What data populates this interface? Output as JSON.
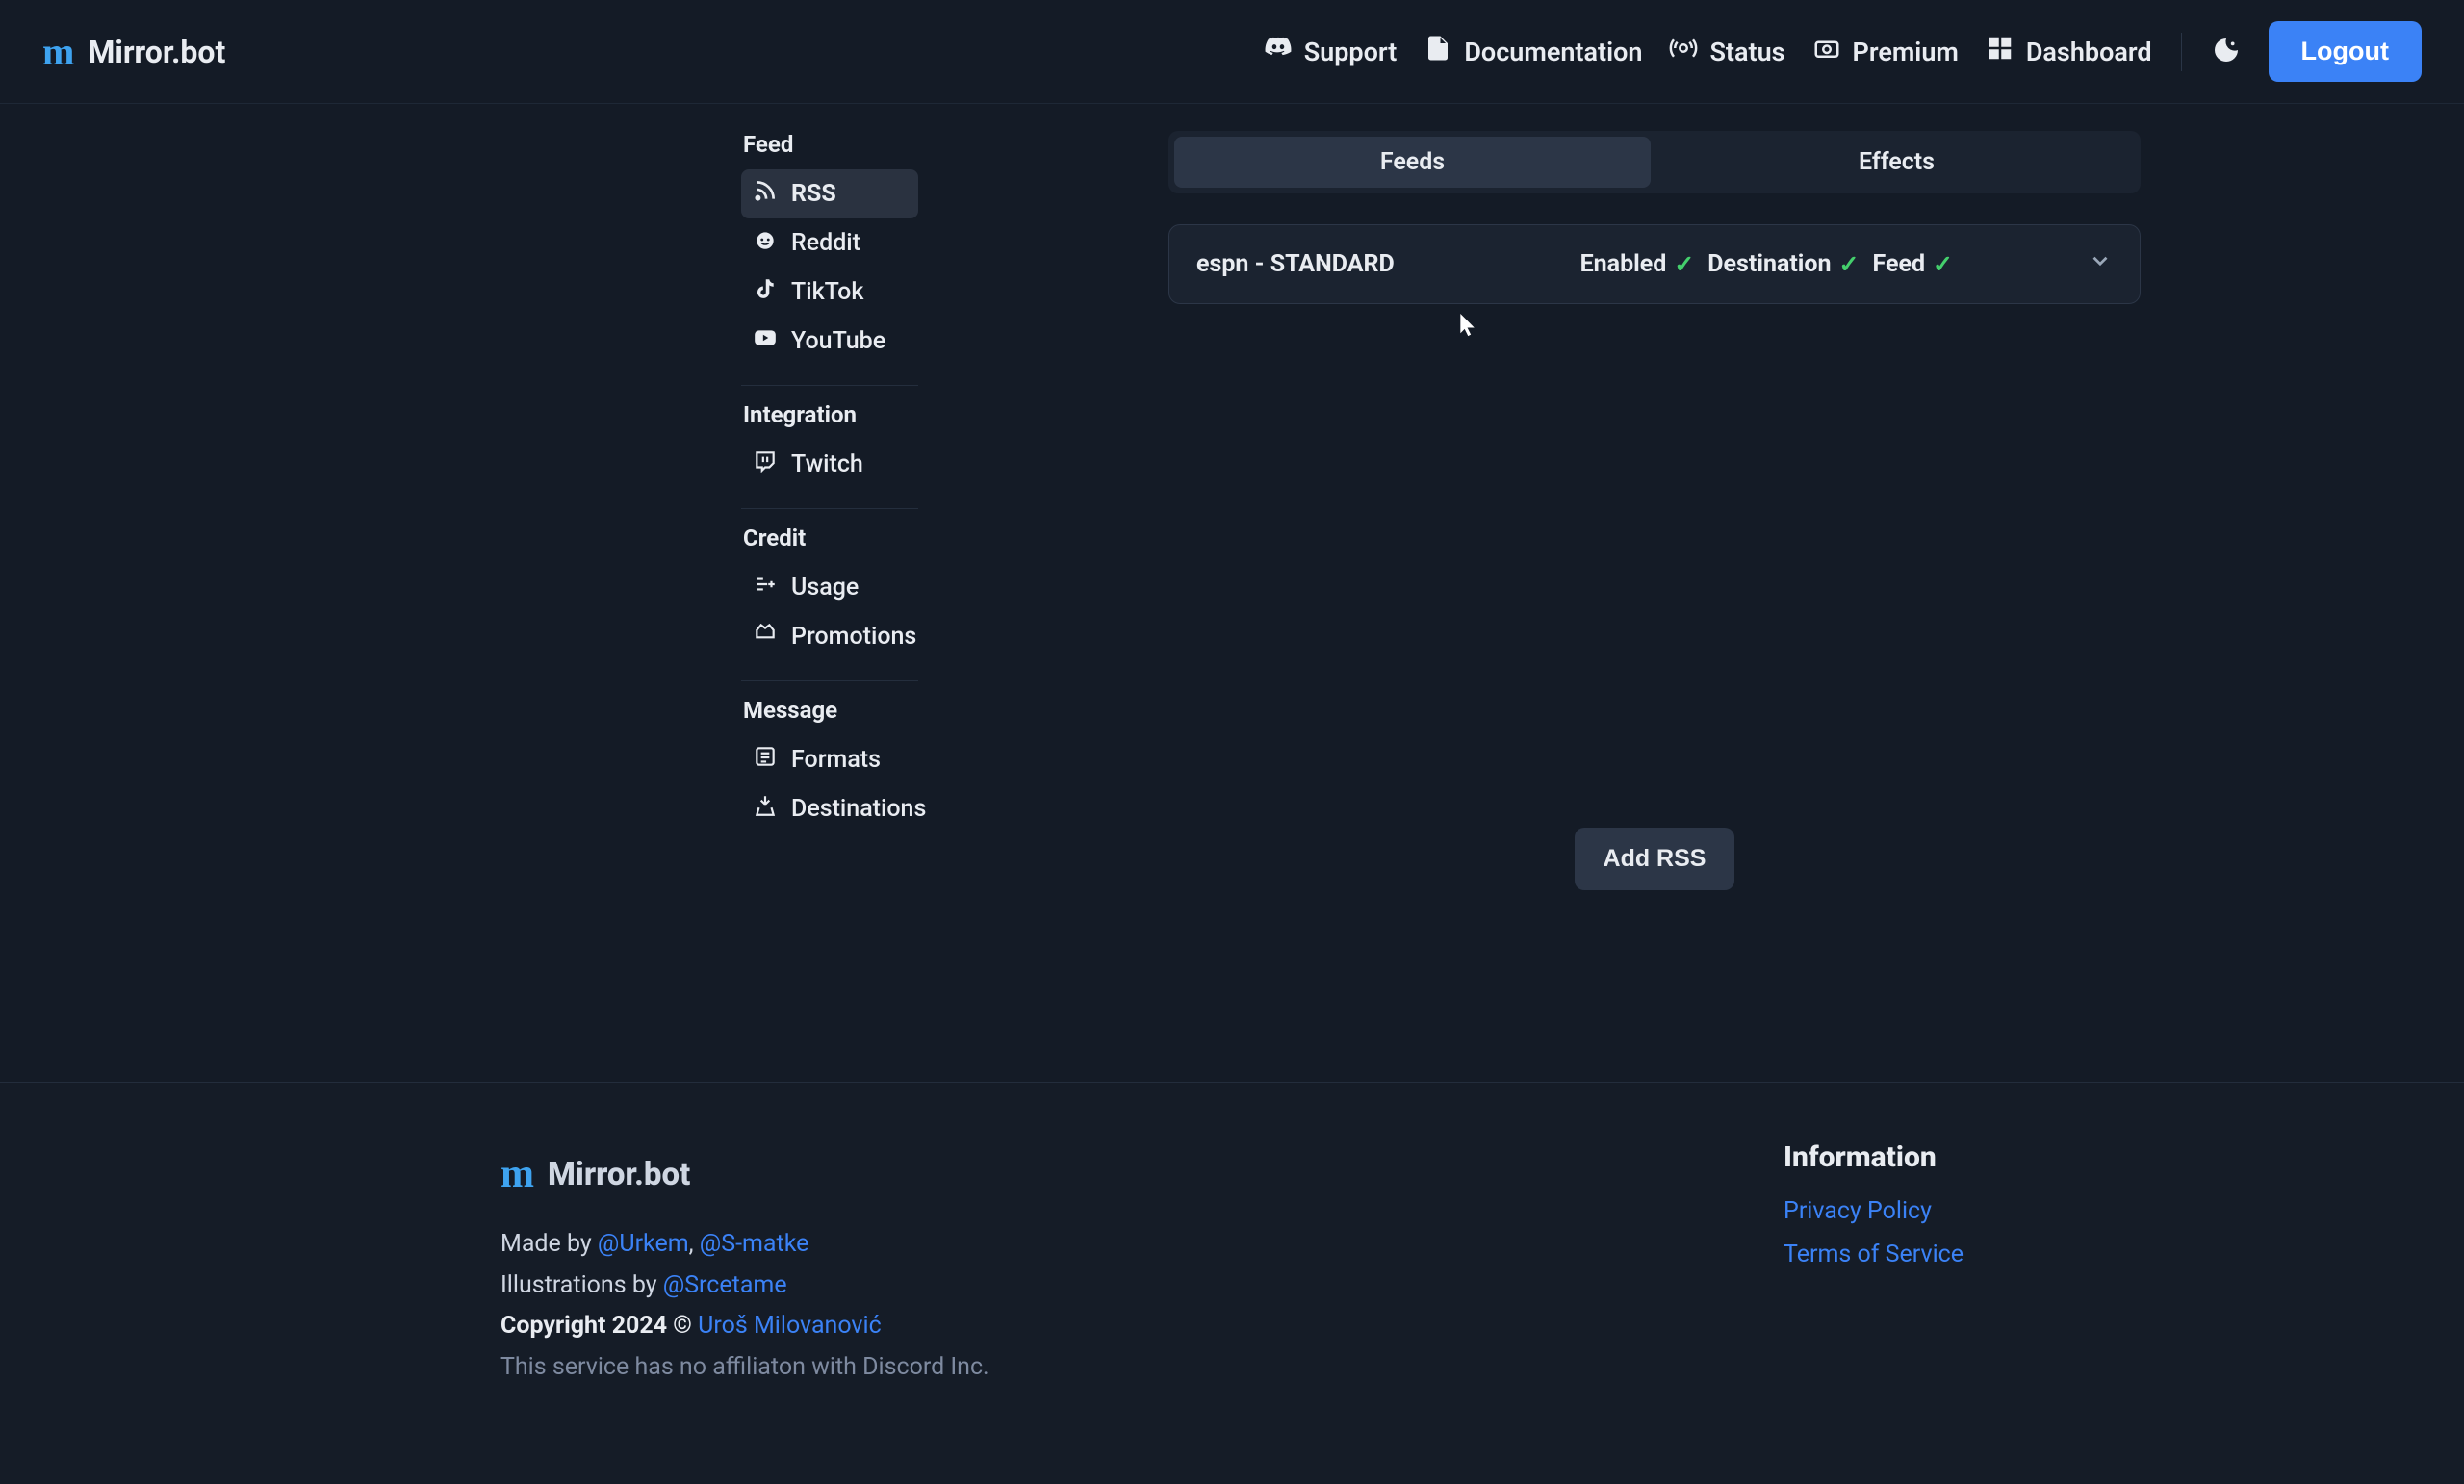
{
  "brand": {
    "name": "Mirror.bot"
  },
  "nav": {
    "support": "Support",
    "documentation": "Documentation",
    "status": "Status",
    "premium": "Premium",
    "dashboard": "Dashboard",
    "logout": "Logout"
  },
  "sidebar": {
    "groups": [
      {
        "title": "Feed",
        "items": [
          {
            "label": "RSS",
            "icon": "rss-icon",
            "active": true
          },
          {
            "label": "Reddit",
            "icon": "reddit-icon"
          },
          {
            "label": "TikTok",
            "icon": "tiktok-icon"
          },
          {
            "label": "YouTube",
            "icon": "youtube-icon"
          }
        ]
      },
      {
        "title": "Integration",
        "items": [
          {
            "label": "Twitch",
            "icon": "twitch-icon"
          }
        ]
      },
      {
        "title": "Credit",
        "items": [
          {
            "label": "Usage",
            "icon": "usage-icon"
          },
          {
            "label": "Promotions",
            "icon": "promotions-icon"
          }
        ]
      },
      {
        "title": "Message",
        "items": [
          {
            "label": "Formats",
            "icon": "formats-icon"
          },
          {
            "label": "Destinations",
            "icon": "destinations-icon"
          }
        ]
      }
    ]
  },
  "main": {
    "tabs": {
      "feeds": "Feeds",
      "effects": "Effects"
    },
    "feed_row": {
      "title": "espn - STANDARD",
      "chips": {
        "enabled": "Enabled",
        "destination": "Destination",
        "feed": "Feed"
      }
    },
    "add_btn": "Add RSS"
  },
  "footer": {
    "brand": "Mirror.bot",
    "made_by_prefix": "Made by ",
    "author1": "@Urkem",
    "sep": ", ",
    "author2": "@S-matke",
    "illus_prefix": "Illustrations by ",
    "illustrator": "@Srcetame",
    "copyright_prefix": "Copyright 2024 © ",
    "copyright_name": "Uroš Milovanović",
    "disclaimer": "This service has no affiliaton with Discord Inc.",
    "info_title": "Information",
    "privacy": "Privacy Policy",
    "tos": "Terms of Service"
  }
}
